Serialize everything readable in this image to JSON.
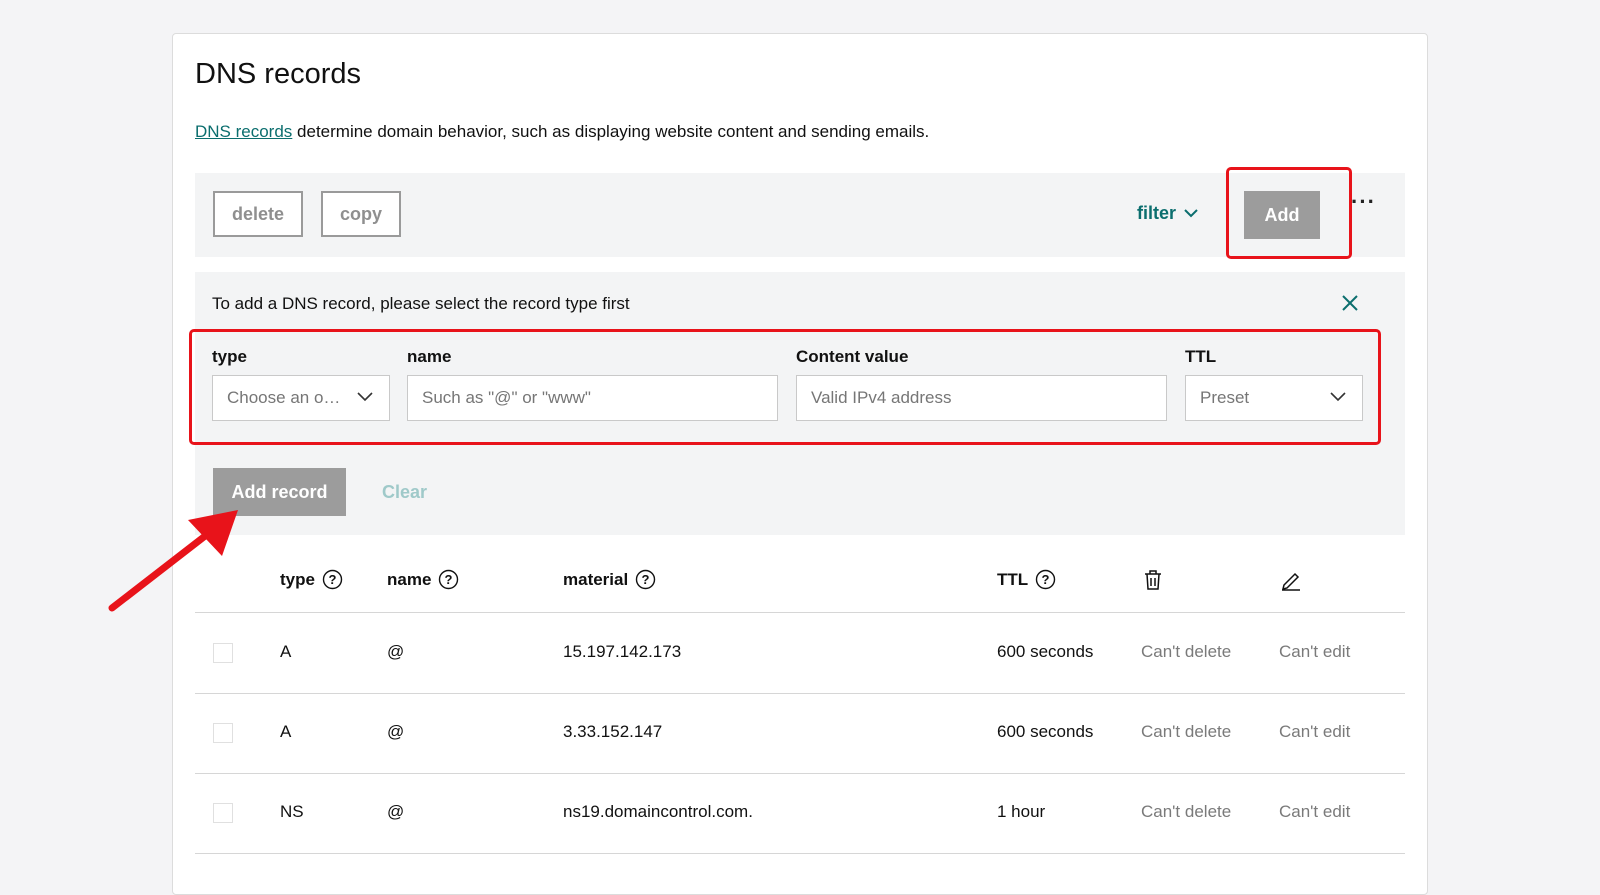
{
  "page": {
    "title": "DNS records",
    "intro_link": "DNS records",
    "intro_text": " determine domain behavior, such as displaying website content and sending emails."
  },
  "toolbar": {
    "delete_label": "delete",
    "copy_label": "copy",
    "filter_label": "filter",
    "add_label": "Add",
    "more_label": "···"
  },
  "add_panel": {
    "message": "To add a DNS record, please select the record type first",
    "fields": {
      "type": {
        "label": "type",
        "value": "Choose an o…"
      },
      "name": {
        "label": "name",
        "placeholder": "Such as \"@\" or \"www\""
      },
      "content": {
        "label": "Content value",
        "placeholder": "Valid IPv4 address"
      },
      "ttl": {
        "label": "TTL",
        "value": "Preset"
      }
    },
    "add_record_label": "Add record",
    "clear_label": "Clear"
  },
  "table": {
    "headers": {
      "type": "type",
      "name": "name",
      "material": "material",
      "ttl": "TTL"
    },
    "rows": [
      {
        "type": "A",
        "name": "@",
        "material": "15.197.142.173",
        "ttl": "600 seconds",
        "delete": "Can't delete",
        "edit": "Can't edit"
      },
      {
        "type": "A",
        "name": "@",
        "material": "3.33.152.147",
        "ttl": "600 seconds",
        "delete": "Can't delete",
        "edit": "Can't edit"
      },
      {
        "type": "NS",
        "name": "@",
        "material": "ns19.domaincontrol.com.",
        "ttl": "1 hour",
        "delete": "Can't delete",
        "edit": "Can't edit"
      }
    ]
  },
  "colors": {
    "link": "#0b6e6e",
    "highlight": "#e8131a",
    "button_disabled": "#9c9c9c"
  },
  "icons": [
    "chevron-down-icon",
    "close-icon",
    "help-icon",
    "trash-icon",
    "pencil-icon",
    "arrow-annotation"
  ]
}
